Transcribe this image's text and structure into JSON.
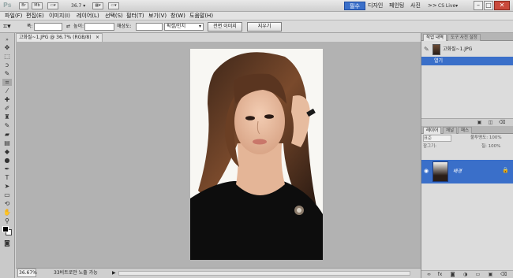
{
  "app": {
    "logo": "Ps",
    "zoom": "36.7",
    "workspaces": [
      "필수",
      "디자인",
      "페인팅",
      "사진"
    ],
    "active_workspace": "필수",
    "more": ">>",
    "cs_live": "CS Live▾",
    "window_controls": [
      "–",
      "□",
      "✕"
    ]
  },
  "menu": [
    "파일(F)",
    "편집(E)",
    "이미지(I)",
    "레이어(L)",
    "선택(S)",
    "필터(T)",
    "보기(V)",
    "창(W)",
    "도움말(H)"
  ],
  "options": {
    "width_label": "폭:",
    "width_value": "",
    "swap": "⇄",
    "height_label": "높이:",
    "height_value": "",
    "resolution_label": "해상도:",
    "resolution_value": "",
    "units": "픽셀/인치",
    "front_image_button": "전면 이미지",
    "clear_button": "지우기"
  },
  "document": {
    "tab_title": "고화질~1.JPG @ 36.7% (RGB/8)",
    "close": "×",
    "zoom_readout": "36.67%",
    "status_info": "33비트로만 노출 가능",
    "status_arrow": "▶"
  },
  "history_panel": {
    "tabs": [
      "작업 내역",
      "도구 사전 설정"
    ],
    "snapshot_label": "고화질~1.JPG",
    "state_label": "열기"
  },
  "layers_panel": {
    "tabs": [
      "레이어",
      "채널",
      "패스"
    ],
    "blend_mode": "표준",
    "opacity_label": "불투명도: 100%",
    "fill_label": "칠: 100%",
    "lock_label": "잠그기:",
    "layer_name": "배경"
  },
  "colors": {
    "accent": "#3a6fc9",
    "panel": "#c9c9c9",
    "canvas": "#b2b2b2"
  }
}
